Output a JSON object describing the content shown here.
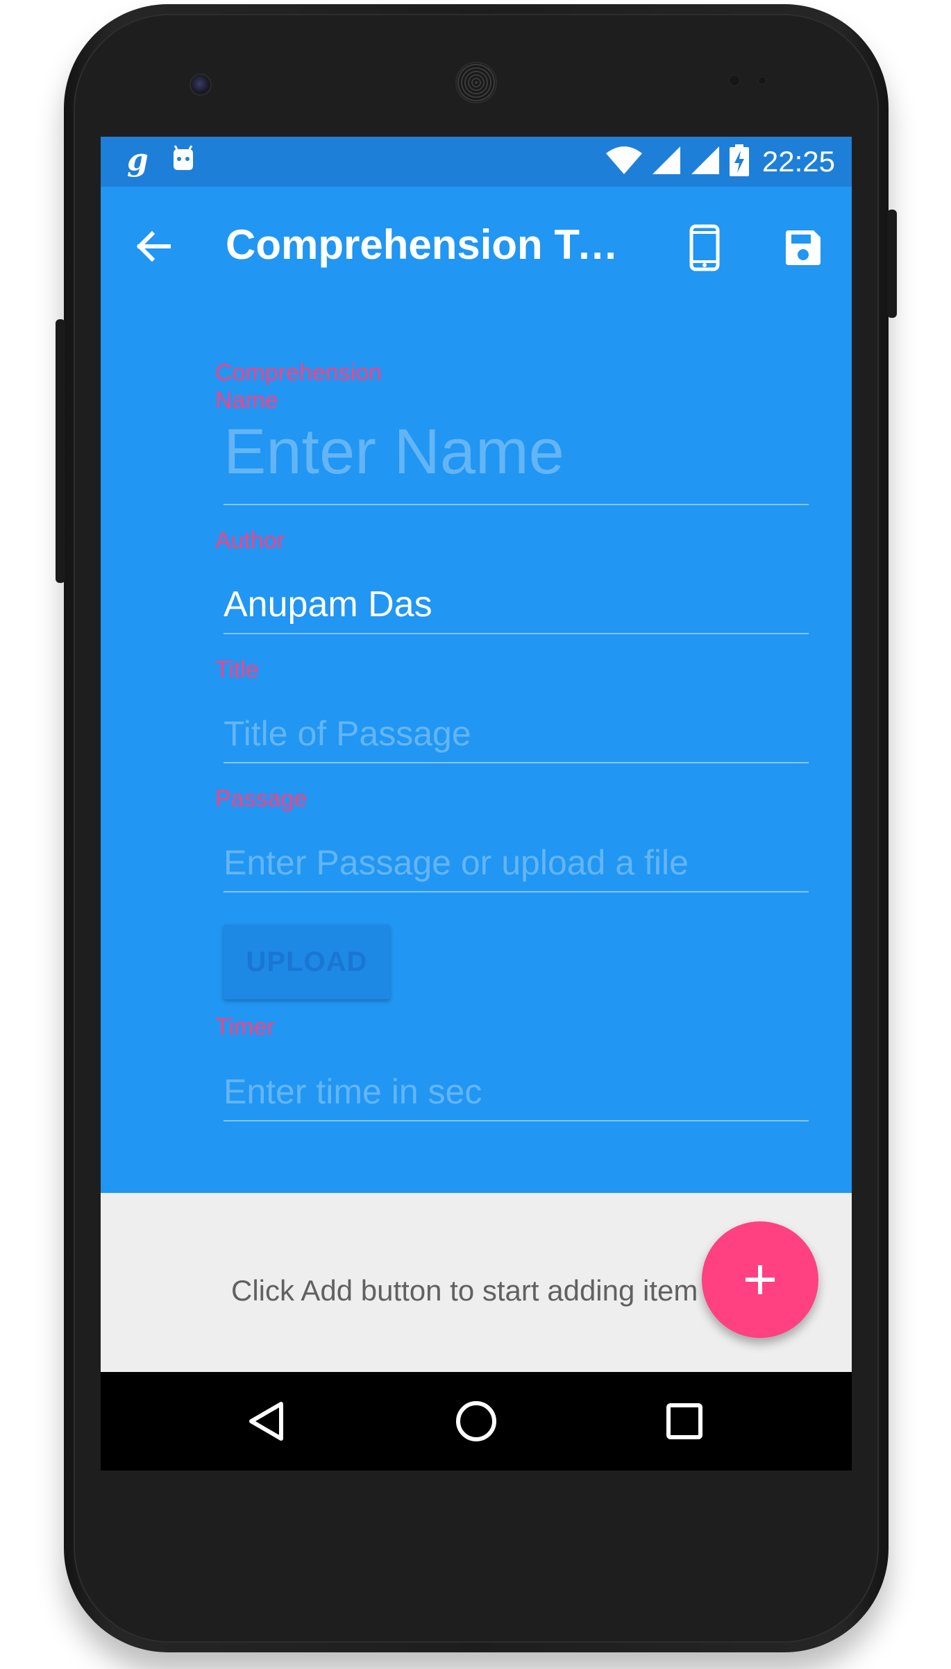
{
  "status_bar": {
    "time": "22:25",
    "left_icons": [
      "goodreads-icon",
      "android-icon"
    ],
    "right_icons": [
      "wifi-icon",
      "signal-icon",
      "signal-icon",
      "battery-charging-icon"
    ]
  },
  "toolbar": {
    "title": "Comprehension Tem...",
    "back_icon": "arrow-back-icon",
    "actions": [
      "phone-preview-icon",
      "save-icon"
    ]
  },
  "form": {
    "comprehension_name": {
      "label": "Comprehension Name",
      "placeholder": "Enter Name",
      "value": ""
    },
    "author": {
      "label": "Author",
      "value": "Anupam Das"
    },
    "title": {
      "label": "Title",
      "placeholder": "Title of Passage",
      "value": ""
    },
    "passage": {
      "label": "Passage",
      "placeholder": "Enter Passage or upload a file",
      "value": ""
    },
    "upload_button": "UPLOAD",
    "timer": {
      "label": "Timer",
      "placeholder": "Enter time in sec",
      "value": ""
    }
  },
  "items_panel": {
    "empty_message": "Click Add button to start adding item"
  },
  "fab": {
    "icon": "plus-icon"
  },
  "navigation_bar": {
    "buttons": [
      "back-triangle-icon",
      "home-circle-icon",
      "recents-square-icon"
    ]
  },
  "colors": {
    "primary": "#2196f3",
    "primary_dark": "#1e7fd9",
    "accent": "#ff4081",
    "panel_bg": "#eeeeee"
  }
}
